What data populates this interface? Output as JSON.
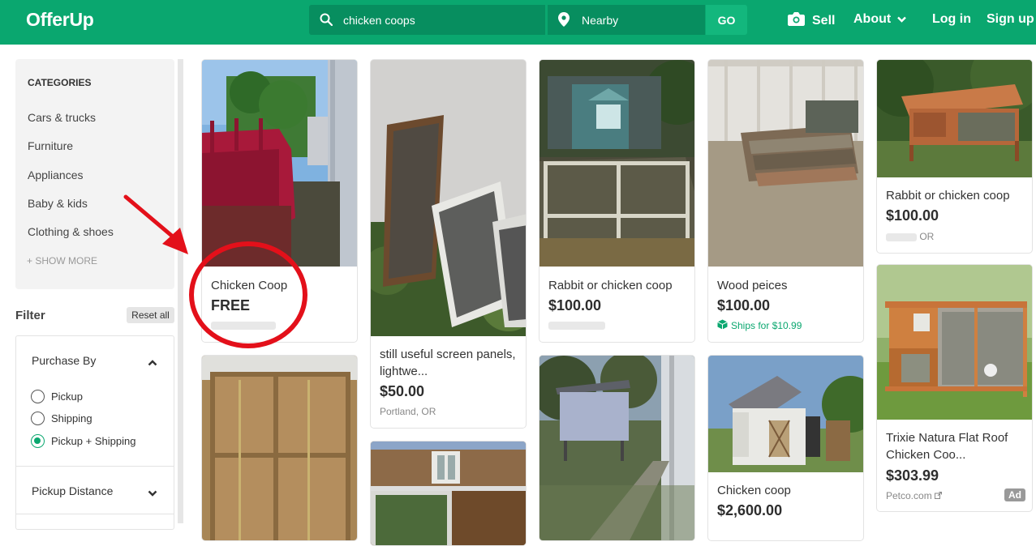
{
  "header": {
    "logo": "OfferUp",
    "search_value": "chicken coops",
    "location_value": "Nearby",
    "go_label": "GO",
    "sell_label": "Sell",
    "about_label": "About",
    "login_label": "Log in",
    "signup_label": "Sign up"
  },
  "sidebar": {
    "categories_title": "CATEGORIES",
    "categories": [
      "Cars & trucks",
      "Furniture",
      "Appliances",
      "Baby & kids",
      "Clothing & shoes"
    ],
    "show_more": "+ SHOW MORE",
    "filter_label": "Filter",
    "reset_label": "Reset all",
    "purchase_by_title": "Purchase By",
    "purchase_options": [
      "Pickup",
      "Shipping",
      "Pickup + Shipping"
    ],
    "selected_option": "Pickup + Shipping",
    "pickup_distance_title": "Pickup Distance"
  },
  "listings": [
    {
      "title": "Chicken Coop",
      "price": "FREE"
    },
    {
      "title": "still useful screen panels, lightwe...",
      "price": "$50.00",
      "location": "Portland, OR"
    },
    {
      "title": "Rabbit or chicken coop",
      "price": "$100.00"
    },
    {
      "title": "Wood peices",
      "price": "$100.00",
      "shipping": "Ships for $10.99"
    },
    {
      "title": "Rabbit or chicken coop",
      "price": "$100.00",
      "location": "OR"
    },
    {
      "title": "Trixie Natura Flat Roof Chicken Coo...",
      "price": "$303.99",
      "seller": "Petco.com",
      "ad_label": "Ad"
    },
    {
      "title": "Chicken coop",
      "price": "$2,600.00"
    }
  ],
  "colors": {
    "brand": "#0aa76f",
    "search_bg": "#078e5f",
    "annotation": "#e3101a"
  }
}
